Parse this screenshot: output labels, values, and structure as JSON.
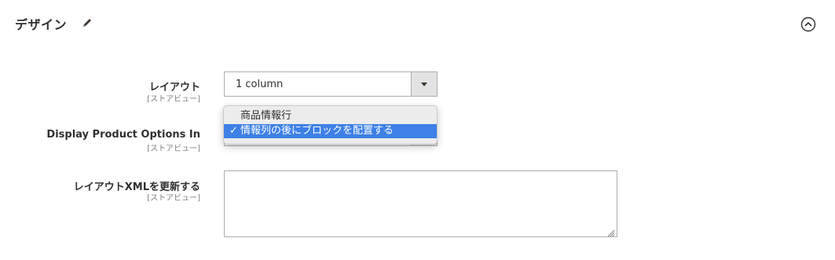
{
  "section": {
    "title": "デザイン",
    "edit_icon": "pencil-icon",
    "collapse_icon": "chevron-up-circle-icon"
  },
  "fields": {
    "layout": {
      "label": "レイアウト",
      "scope": "[ストアビュー]",
      "value": "1 column"
    },
    "display_product_options": {
      "label": "Display Product Options In",
      "scope": "[ストアビュー]"
    },
    "layout_xml": {
      "label": "レイアウトXMLを更新する",
      "scope": "[ストアビュー]",
      "value": ""
    }
  },
  "dropdown": {
    "options": [
      {
        "label": "商品情報行",
        "selected": false
      },
      {
        "label": "情報列の後にブロックを配置する",
        "selected": true
      }
    ],
    "check_glyph": "✓"
  },
  "colors": {
    "selected_bg": "#3e80e6",
    "text": "#303030",
    "scope_text": "#808080",
    "border": "#adadad"
  }
}
